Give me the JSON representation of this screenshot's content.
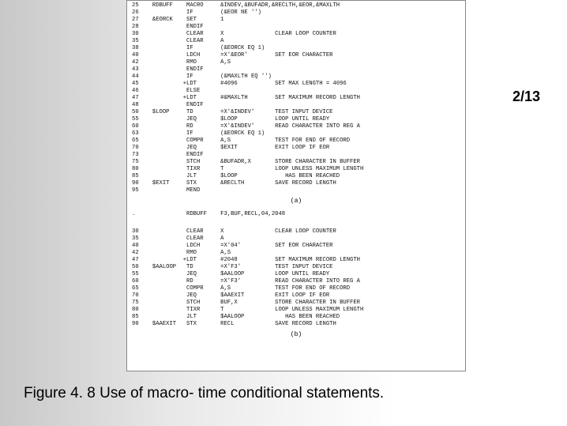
{
  "page_indicator": "2/13",
  "caption": "Figure 4. 8 Use of macro- time conditional statements.",
  "part_a_label": "(a)",
  "part_b_label": "(b)",
  "code_a": "25    RDBUFF    MACRO     &INDEV,&BUFADR,&RECLTH,&EOR,&MAXLTH\n26              IF        (&EOR NE '')\n27    &EORCK    SET       1\n28              ENDIF\n30              CLEAR     X               CLEAR LOOP COUNTER\n35              CLEAR     A\n38              IF        (&EORCK EQ 1)\n40              LDCH      =X'&EOR'        SET EOR CHARACTER\n42              RMO       A,S\n43              ENDIF\n44              IF        (&MAXLTH EQ '')\n45             +LDT       #4096           SET MAX LENGTH = 4096\n46              ELSE\n47             +LDT       #&MAXLTH        SET MAXIMUM RECORD LENGTH\n48              ENDIF\n50    $LOOP     TD        =X'&INDEV'      TEST INPUT DEVICE\n55              JEQ       $LOOP           LOOP UNTIL READY\n60              RD        =X'&INDEV'      READ CHARACTER INTO REG A\n63              IF        (&EORCK EQ 1)\n65              COMPR     A,S             TEST FOR END OF RECORD\n70              JEQ       $EXIT           EXIT LOOP IF EOR\n73              ENDIF\n75              STCH      &BUFADR,X       STORE CHARACTER IN BUFFER\n80              TIXR      T               LOOP UNLESS MAXIMUM LENGTH\n85              JLT       $LOOP              HAS BEEN REACHED\n90    $EXIT     STX       &RECLTH         SAVE RECORD LENGTH\n95              MEND",
  "code_b_header": ".               RDBUFF    F3,BUF,RECL,04,2048\n\n",
  "code_b": "30              CLEAR     X               CLEAR LOOP COUNTER\n35              CLEAR     A\n40              LDCH      =X'04'          SET EOR CHARACTER\n42              RMO       A,S\n47             +LDT       #2048           SET MAXIMUM RECORD LENGTH\n50    $AALOOP   TD        =X'F3'          TEST INPUT DEVICE\n55              JEQ       $AALOOP         LOOP UNTIL READY\n60              RD        =X'F3'          READ CHARACTER INTO REG A\n65              COMPR     A,S             TEST FOR END OF RECORD\n70              JEQ       $AAEXIT         EXIT LOOP IF EOR\n75              STCH      BUF,X           STORE CHARACTER IN BUFFER\n80              TIXR      T               LOOP UNLESS MAXIMUM LENGTH\n85              JLT       $AALOOP            HAS BEEN REACHED\n90    $AAEXIT   STX       RECL            SAVE RECORD LENGTH"
}
